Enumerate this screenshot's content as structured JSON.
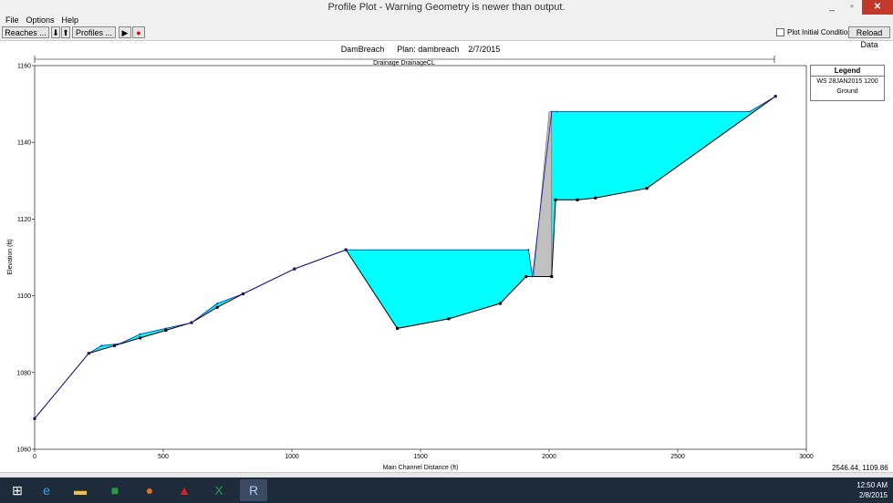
{
  "window": {
    "title": "Profile Plot - Warning Geometry is newer than output.",
    "minimize": "_",
    "maximize": "▫",
    "close": "✕"
  },
  "menu": {
    "items": [
      "File",
      "Options",
      "Help"
    ]
  },
  "toolbar": {
    "reaches": "Reaches ...",
    "down_arrow": "⬇",
    "up_arrow": "⬆",
    "profiles": "Profiles ...",
    "play": "▶",
    "record": "●",
    "plot_initial": "Plot Initial Conditions",
    "reload": "Reload Data"
  },
  "plot": {
    "header": {
      "name": "DamBreach",
      "plan": "Plan: dambreach",
      "date": "2/7/2015"
    },
    "reach_label": "Drainage DrainageCL",
    "coord_readout": "2546.44, 1109.86"
  },
  "legend": {
    "title": "Legend",
    "ws_label": "WS  28JAN2015 1200",
    "ground_label": "Ground"
  },
  "colors": {
    "water": "#00ffff",
    "structure": "#c0c0c0",
    "ground": "#000000",
    "ws_line": "#1a1aa0"
  },
  "chart_data": {
    "type": "line",
    "xlabel": "Main Channel Distance (ft)",
    "ylabel": "Elevation (ft)",
    "xlim": [
      0,
      3000
    ],
    "ylim": [
      1060,
      1160
    ],
    "xticks": [
      0,
      500,
      1000,
      1500,
      2000,
      2500,
      3000
    ],
    "yticks": [
      1060,
      1080,
      1100,
      1120,
      1140,
      1160
    ],
    "series": [
      {
        "name": "Ground",
        "x": [
          0,
          210,
          310,
          410,
          510,
          610,
          710,
          810,
          1010,
          1210,
          1410,
          1610,
          1810,
          1910,
          2010,
          2025,
          2110,
          2180,
          2380,
          2880
        ],
        "y": [
          1068,
          1085,
          1087,
          1089,
          1091,
          1093,
          1097,
          1100.5,
          1107,
          1112,
          1091.5,
          1094,
          1098,
          1105,
          1105,
          1125,
          1125,
          1125.5,
          1128,
          1152
        ]
      },
      {
        "name": "WS  28JAN2015 1200",
        "x": [
          0,
          210,
          260,
          330,
          410,
          510,
          610,
          710,
          810,
          1010,
          1210,
          1920,
          1935,
          2010,
          2030,
          2780,
          2880
        ],
        "y": [
          1068,
          1085,
          1087,
          1087.5,
          1090,
          1091.5,
          1093,
          1098,
          1100.5,
          1107,
          1112,
          1112,
          1105,
          1148,
          1148,
          1148,
          1152
        ]
      }
    ],
    "structure": {
      "x": [
        1940,
        2000,
        2010,
        2010,
        1940
      ],
      "y": [
        1105,
        1148,
        1148,
        1105,
        1105
      ]
    }
  }
}
